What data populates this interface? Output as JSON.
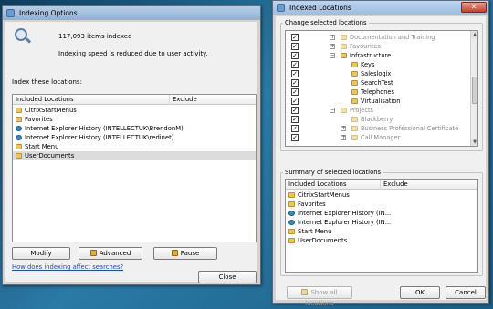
{
  "indexing_options": {
    "title": "Indexing Options",
    "items_indexed": "117,093 items indexed",
    "speed_note": "Indexing speed is reduced due to user activity.",
    "index_these_label": "Index these locations:",
    "columns": [
      "Included Locations",
      "Exclude"
    ],
    "locations": [
      {
        "name": "CitrixStartMenus",
        "icon": "folder-icon"
      },
      {
        "name": "Favorites",
        "icon": "folder-icon"
      },
      {
        "name": "Internet Explorer History (INTELLECTUK\\BrendonM)",
        "icon": "ie-icon"
      },
      {
        "name": "Internet Explorer History (INTELLECTUK\\redinet)",
        "icon": "ie-icon"
      },
      {
        "name": "Start Menu",
        "icon": "start-menu-icon"
      },
      {
        "name": "UserDocuments",
        "icon": "folder-icon"
      }
    ],
    "buttons": {
      "modify": "Modify",
      "advanced": "Advanced",
      "pause": "Pause",
      "close": "Close"
    },
    "help_link": "How does indexing affect searches?"
  },
  "indexed_locations": {
    "title": "Indexed Locations",
    "change_label": "Change selected locations",
    "tree": [
      {
        "label": "Documentation and Training",
        "expander": "+",
        "dim": true
      },
      {
        "label": "Favourites",
        "expander": "+",
        "dim": true
      },
      {
        "label": "Infrastructure",
        "expander": "-",
        "dim": false
      },
      {
        "label": "Keys",
        "expander": "",
        "dim": false
      },
      {
        "label": "Saleslogix",
        "expander": "",
        "dim": false
      },
      {
        "label": "SearchTest",
        "expander": "",
        "dim": false
      },
      {
        "label": "Telephones",
        "expander": "",
        "dim": false
      },
      {
        "label": "Virtualisation",
        "expander": "",
        "dim": false
      },
      {
        "label": "Projects",
        "expander": "-",
        "dim": true
      },
      {
        "label": "Blackberry",
        "expander": "",
        "dim": true
      },
      {
        "label": "Business Professional Certificate",
        "expander": "+",
        "dim": true
      },
      {
        "label": "Call Manager",
        "expander": "+",
        "dim": true
      }
    ],
    "summary_label": "Summary of selected locations",
    "summary_columns": [
      "Included Locations",
      "Exclude"
    ],
    "summary": [
      {
        "name": "CitrixStartMenus",
        "icon": "folder-icon"
      },
      {
        "name": "Favorites",
        "icon": "folder-icon"
      },
      {
        "name": "Internet Explorer History (IN...",
        "icon": "ie-icon"
      },
      {
        "name": "Internet Explorer History (IN...",
        "icon": "ie-icon"
      },
      {
        "name": "Start Menu",
        "icon": "start-menu-icon"
      },
      {
        "name": "UserDocuments",
        "icon": "folder-icon"
      }
    ],
    "buttons": {
      "show_all": "Show all locations",
      "ok": "OK",
      "cancel": "Cancel"
    }
  },
  "colors": {
    "desktop": "#1f5f84",
    "selection": "#dcdcdc",
    "link": "#1a4ec2"
  }
}
